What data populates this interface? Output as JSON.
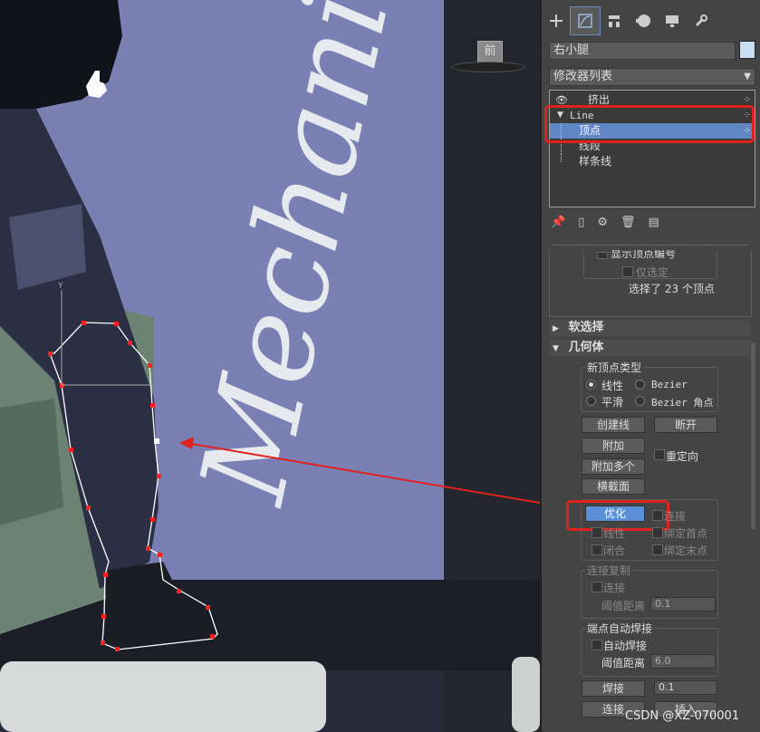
{
  "viewport": {
    "label": "前",
    "background_text": "Mechanic"
  },
  "panel": {
    "tabs": [
      "create-icon",
      "modify-icon",
      "hierarchy-icon",
      "motion-icon",
      "display-icon",
      "utilities-icon"
    ],
    "object_name": "右小腿",
    "modifier_list": "修改器列表",
    "stack": {
      "items": [
        {
          "label": "挤出"
        },
        {
          "label": "Line"
        },
        {
          "label": "顶点"
        },
        {
          "label": "线段"
        },
        {
          "label": "样条线"
        }
      ]
    },
    "selection_info": {
      "show_vertex_numbers": "显示顶点编号",
      "selected_only": "仅选定",
      "selected_count": "选择了 23 个顶点"
    },
    "soft_selection": "软选择",
    "geometry": {
      "title": "几何体",
      "new_vertex_type": "新顶点类型",
      "linear": "线性",
      "bezier": "Bezier",
      "smooth": "平滑",
      "bezier_corner": "Bezier 角点",
      "create_line": "创建线",
      "break": "断开",
      "attach": "附加",
      "reorient": "重定向",
      "attach_multiple": "附加多个",
      "cross_section": "横截面",
      "refine": "优化",
      "connect": "连接",
      "linear2": "线性",
      "bind_first": "绑定首点",
      "closed": "闭合",
      "bind_last": "绑定末点",
      "connect_copy": "连接复制",
      "connect2": "连接",
      "threshold_distance": "阈值距离",
      "threshold_value": "0.1",
      "end_auto_weld": "端点自动焊接",
      "auto_weld": "自动焊接",
      "threshold_distance2": "阈值距离",
      "weld_value": "6.0",
      "weld": "焊接",
      "weld_amount": "0.1",
      "connect3": "连接",
      "insert": "插入"
    }
  },
  "watermark": "CSDN @XZ-070001"
}
